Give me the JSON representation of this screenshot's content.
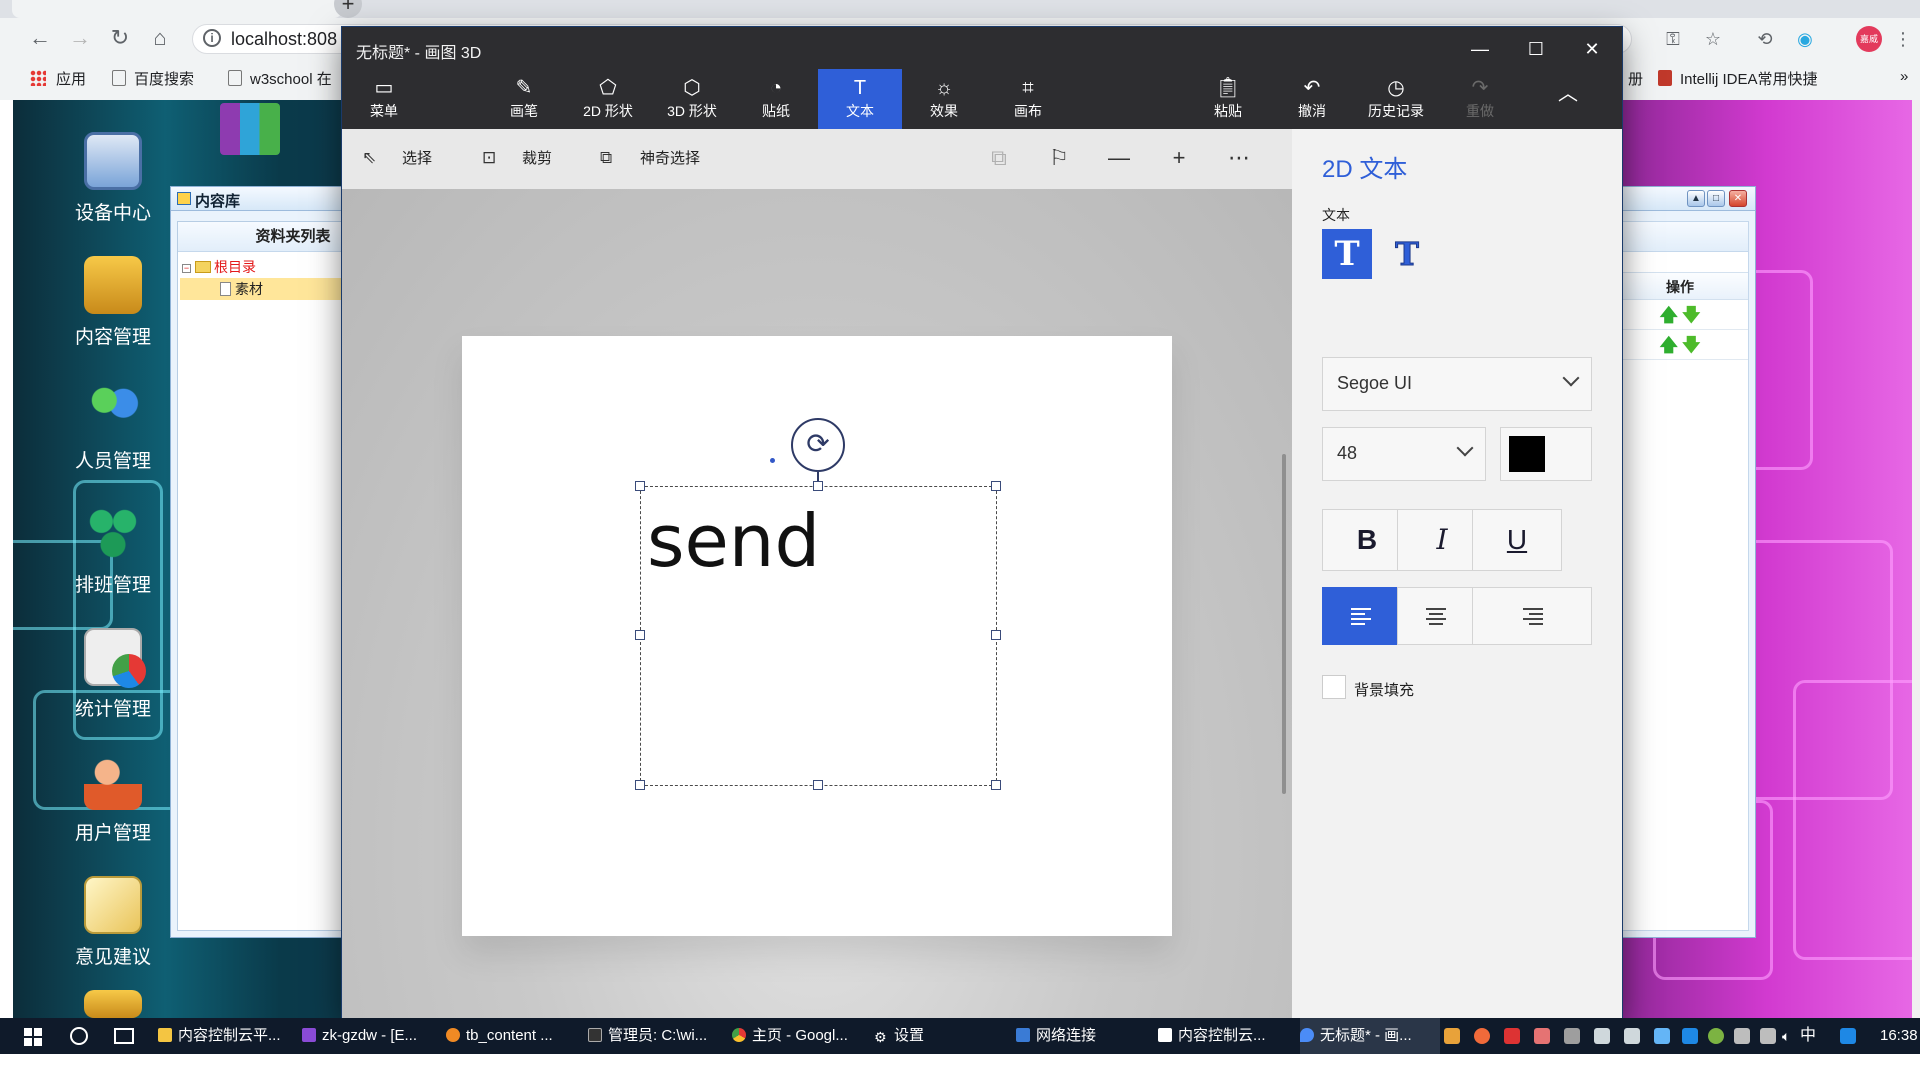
{
  "browser": {
    "url": "localhost:808",
    "bookmarks": {
      "apps": "应用",
      "baidu": "百度搜索",
      "w3school": "w3school 在",
      "partial": "册",
      "intellij": "Intellij IDEA常用快捷"
    },
    "more_glyph": "»",
    "profile_initials": "嘉威"
  },
  "desktop": {
    "icons": [
      {
        "label": "设备中心"
      },
      {
        "label": "内容管理"
      },
      {
        "label": "人员管理"
      },
      {
        "label": "排班管理"
      },
      {
        "label": "统计管理"
      },
      {
        "label": "用户管理"
      },
      {
        "label": "意见建议"
      }
    ]
  },
  "content_library": {
    "title": "内容库",
    "panel_header": "资料夹列表",
    "tree": {
      "root": "根目录",
      "child": "素材"
    }
  },
  "right_window": {
    "column_header": "操作",
    "rows": [
      {
        "up": "🡅",
        "down": "🡇"
      },
      {
        "up": "🡅",
        "down": "🡇"
      }
    ]
  },
  "paint3d": {
    "title": "无标题* - 画图 3D",
    "ribbon": {
      "menu": "菜单",
      "brushes": "画笔",
      "shapes2d": "2D 形状",
      "shapes3d": "3D 形状",
      "stickers": "贴纸",
      "text": "文本",
      "effects": "效果",
      "canvas": "画布",
      "paste": "粘贴",
      "undo": "撤消",
      "history": "历史记录",
      "redo": "重做"
    },
    "toolbar": {
      "select": "选择",
      "crop": "裁剪",
      "magic_select": "神奇选择"
    },
    "canvas_text": "send",
    "panel": {
      "title": "2D 文本",
      "text_section": "文本",
      "text2d_glyph": "T",
      "text3d_glyph": "T",
      "font": "Segoe UI",
      "size": "48",
      "text_color": "#000000",
      "bold": "B",
      "italic": "I",
      "underline": "U",
      "background_fill_label": "背景填充",
      "background_fill_checked": false,
      "alignment": "left"
    },
    "accent_color": "#2f5fd8"
  },
  "taskbar": {
    "items": [
      {
        "label": "内容控制云平..."
      },
      {
        "label": "zk-gzdw - [E..."
      },
      {
        "label": "tb_content ..."
      },
      {
        "label": "管理员: C:\\wi..."
      },
      {
        "label": "主页 - Googl..."
      },
      {
        "label": "设置"
      },
      {
        "label": "网络连接"
      },
      {
        "label": "内容控制云..."
      },
      {
        "label": "无标题* - 画..."
      }
    ],
    "ime": "中",
    "clock": "16:38"
  }
}
